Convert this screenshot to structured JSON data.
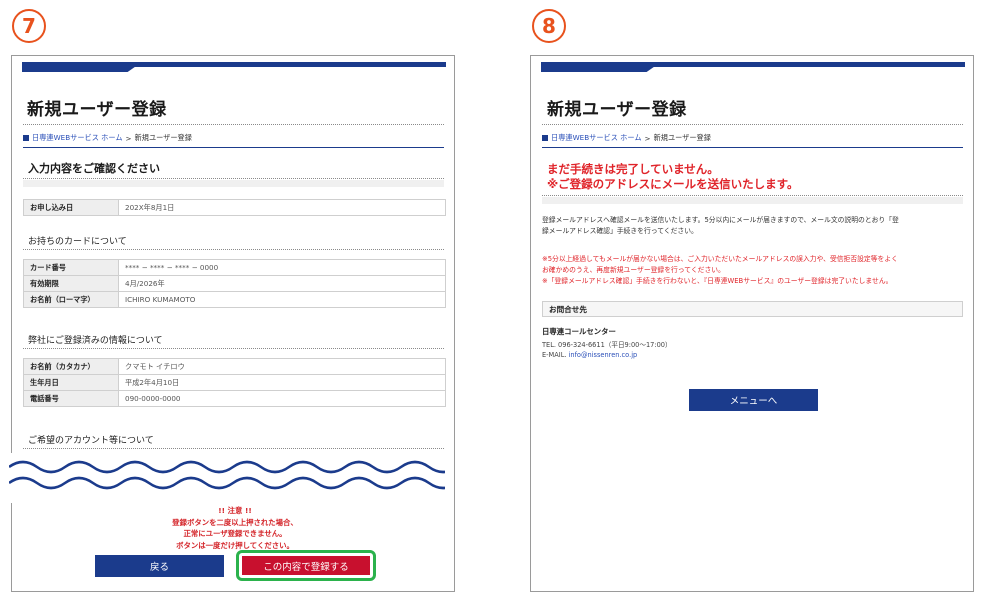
{
  "steps": {
    "left": "7",
    "right": "8"
  },
  "colors": {
    "brand_blue": "#1b3b8c",
    "alert_red": "#e0242a",
    "highlight_green": "#2bb24c",
    "step_orange": "#e8521d"
  },
  "left_panel": {
    "title": "新規ユーザー登録",
    "breadcrumb": {
      "home": "日専連WEBサービス ホーム",
      "separator": ">",
      "current": "新規ユーザー登録"
    },
    "confirm_heading": "入力内容をご確認ください",
    "application_table": [
      {
        "label": "お申し込み日",
        "value": "202X年8月1日"
      }
    ],
    "card_section_heading": "お持ちのカードについて",
    "card_table": [
      {
        "label": "カード番号",
        "value": "**** − **** − **** − 0000"
      },
      {
        "label": "有効期限",
        "value": "4月/2026年"
      },
      {
        "label": "お名前（ローマ字）",
        "value": "ICHIRO KUMAMOTO"
      }
    ],
    "registered_section_heading": "弊社にご登録済みの情報について",
    "registered_table": [
      {
        "label": "お名前（カタカナ）",
        "value": "クマモト イチロウ"
      },
      {
        "label": "生年月日",
        "value": "平成2年4月10日"
      },
      {
        "label": "電話番号",
        "value": "090-0000-0000"
      }
    ],
    "account_section_heading": "ご希望のアカウント等について",
    "caution": {
      "title": "!! 注意 !!",
      "line1": "登録ボタンを二度以上押された場合、",
      "line2": "正常にユーザ登録できません。",
      "line3": "ボタンは一度だけ押してください。"
    },
    "back_button": "戻る",
    "register_button": "この内容で登録する"
  },
  "right_panel": {
    "title": "新規ユーザー登録",
    "breadcrumb": {
      "home": "日専連WEBサービス ホーム",
      "separator": ">",
      "current": "新規ユーザー登録"
    },
    "alert_line1": "まだ手続きは完了していません。",
    "alert_line2": "※ご登録のアドレスにメールを送信いたします。",
    "body_line1": "登録メールアドレスへ確認メールを送信いたします。5分以内にメールが届きますので、メール文の説明のとおり「登",
    "body_line2": "録メールアドレス確認」手続きを行ってください。",
    "notice_line1": "※5分以上経過してもメールが届かない場合は、ご入力いただいたメールアドレスの誤入力や、受信拒否設定等をよく",
    "notice_line2": "お確かめのうえ、再度新規ユーザー登録を行ってください。",
    "notice_line3": "※「登録メールアドレス確認」手続きを行わないと、『日専連WEBサービス』のユーザー登録は完了いたしません。",
    "contact_heading": "お問合せ先",
    "contact_name": "日専連コールセンター",
    "contact_tel": "TEL. 096-324-6611（平日9:00〜17:00）",
    "contact_email_label": "E-MAIL.",
    "contact_email": "info@nissenren.co.jp",
    "menu_button": "メニューへ"
  }
}
